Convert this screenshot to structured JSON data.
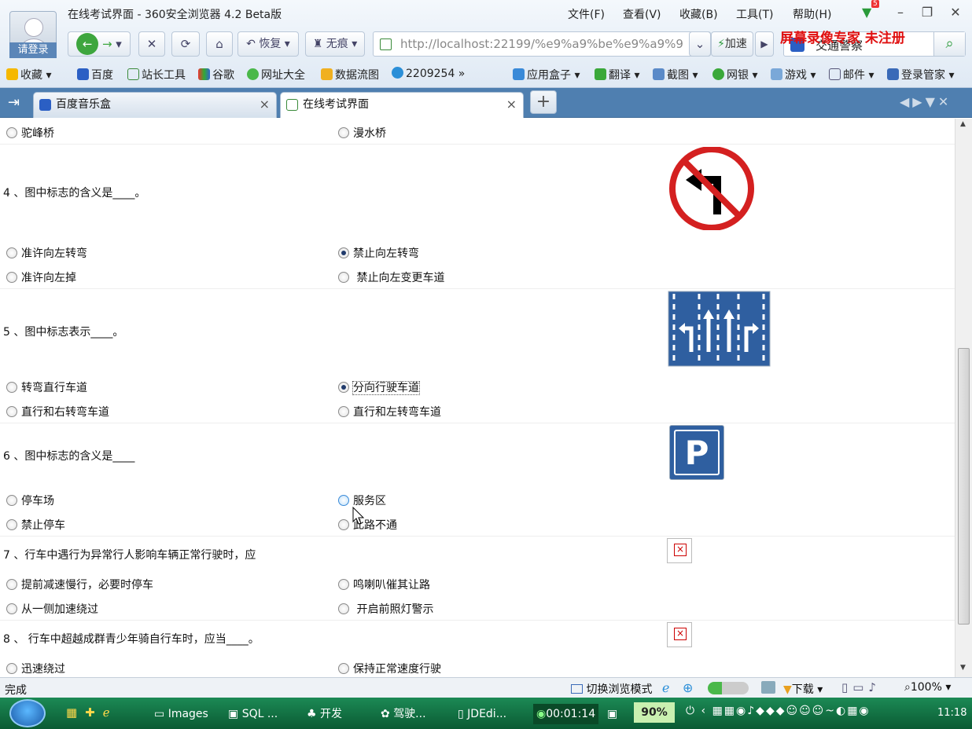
{
  "window": {
    "title": "在线考试界面 - 360安全浏览器 4.2 Beta版",
    "login_label": "请登录",
    "menu": [
      "文件(F)",
      "查看(V)",
      "收藏(B)",
      "工具(T)",
      "帮助(H)"
    ],
    "badge": "5"
  },
  "nav": {
    "restore_label": "恢复",
    "privacy_label": "无痕",
    "url": "http://localhost:22199/%e9%a9%be%e9%a9%99",
    "speed_label": "加速",
    "search_value": "交通警察",
    "watermark": "屏幕录像专家 未注册"
  },
  "favorites": {
    "items": [
      "收藏",
      "百度",
      "站长工具",
      "谷歌",
      "网址大全",
      "数据流图",
      "2209254"
    ],
    "right_items": [
      "应用盒子",
      "翻译",
      "截图",
      "网银",
      "游戏",
      "邮件",
      "登录管家"
    ]
  },
  "tabs": [
    {
      "label": "百度音乐盒"
    },
    {
      "label": "在线考试界面"
    }
  ],
  "exam": {
    "q3_options": [
      "驼峰桥",
      "漫水桥"
    ],
    "q4": {
      "text": "4 、图中标志的含义是____。",
      "options": [
        "准许向左转弯",
        "禁止向左转弯",
        "准许向左掉",
        "禁止向左变更车道"
      ]
    },
    "q5": {
      "text": "5 、图中标志表示____。",
      "options": [
        "转弯直行车道",
        "分向行驶车道",
        "直行和右转弯车道",
        "直行和左转弯车道"
      ]
    },
    "q6": {
      "text": "6 、图中标志的含义是____",
      "options": [
        "停车场",
        "服务区",
        "禁止停车",
        "此路不通"
      ],
      "sign_letter": "P"
    },
    "q7": {
      "text": "7 、行车中遇行为异常行人影响车辆正常行驶时，应",
      "options": [
        "提前减速慢行，必要时停车",
        "鸣喇叭催其让路",
        "从一侧加速绕过",
        "开启前照灯警示"
      ]
    },
    "q8": {
      "text": "8 、 行车中超越成群青少年骑自行车时，应当____。",
      "options": [
        "迅速绕过",
        "保持正常速度行驶"
      ]
    }
  },
  "status": {
    "text": "完成",
    "mode_label": "切换浏览模式",
    "download_label": "下载",
    "zoom": "100%"
  },
  "taskbar": {
    "items": [
      "Images",
      "SQL ...",
      "开发",
      "驾驶...",
      "JDEdi..."
    ],
    "timer": "00:01:14",
    "battery": "90%",
    "clock": "11:18"
  }
}
